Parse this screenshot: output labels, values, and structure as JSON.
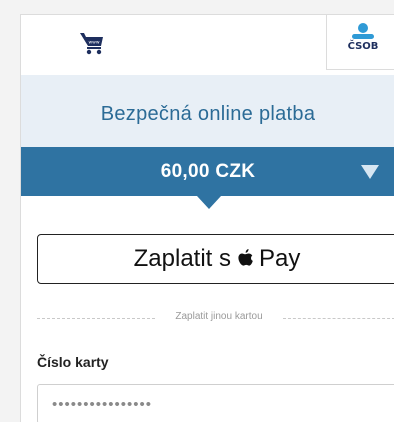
{
  "tabs": {
    "cart_icon": "shopping-cart-icon",
    "cart_icon_text": "www",
    "bank_logo_text": "ČSOB"
  },
  "header": {
    "title": "Bezpečná online platba"
  },
  "amount": {
    "value": "60,00 CZK",
    "toggle_icon": "triangle-down-icon"
  },
  "applepay": {
    "prefix": "Zaplatit s",
    "brand": "Pay"
  },
  "divider": {
    "label": "Zaplatit jinou kartou"
  },
  "card_number": {
    "label": "Číslo karty",
    "placeholder": "••••••••••••••••"
  },
  "colors": {
    "accent": "#2f73a2",
    "header_bg": "#e8eff6",
    "title_text": "#2b6b96",
    "bank_navy": "#1e2f5e",
    "bank_blue": "#2f9ad6"
  }
}
